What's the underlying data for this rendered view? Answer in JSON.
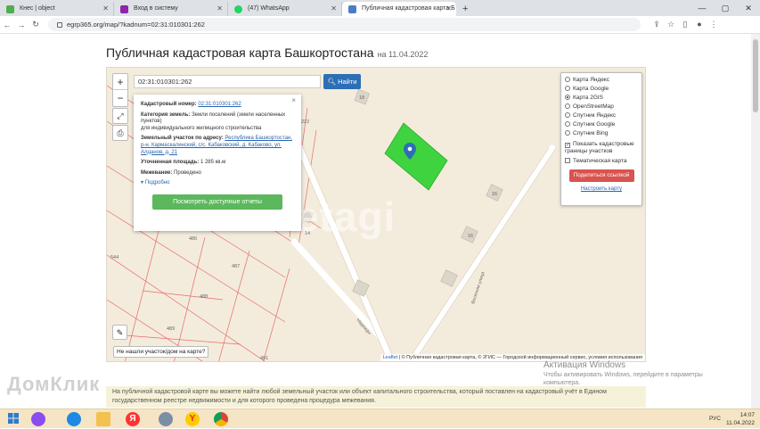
{
  "browser": {
    "tabs": [
      {
        "title": "Кнес | object",
        "color": "#4caf50",
        "active": false
      },
      {
        "title": "Вход в систему",
        "color": "#8e24aa",
        "active": false
      },
      {
        "title": "(47) WhatsApp",
        "color": "#25d366",
        "active": false
      },
      {
        "title": "Публичная кадастровая карта Б",
        "color": "#4a7cc7",
        "active": true
      }
    ],
    "new_tab": "+",
    "url": "egrp365.org/map/?kadnum=02:31:010301:262",
    "window_controls": [
      "—",
      "▢",
      "✕"
    ]
  },
  "page": {
    "title": "Публичная кадастровая карта Башкортостана",
    "date_suffix": "на 11.04.2022"
  },
  "map": {
    "search_value": "02:31:010301:262",
    "search_button": "Найти",
    "zoom_in": "+",
    "zoom_out": "−",
    "popup": {
      "close": "×",
      "cadnum_label": "Кадастровый номер:",
      "cadnum_value": "02:31:010301:262",
      "category_label": "Категория земель:",
      "category_value": "Земли поселений (земли населенных пунктов)",
      "category_value_2": "для индивидуального жилищного строительства",
      "address_label": "Земельный участок по адресу:",
      "address_value": "Республика Башкортостан, р-н. Кармаскалинский, с/с. Кабаковский, д. Кабаково, ул. Алданов, д. 21",
      "area_label": "Уточненная площадь:",
      "area_value": "1 285 кв.м",
      "survey_label": "Межевание:",
      "survey_value": "Проведено",
      "more_link": "Подробно",
      "report_button": "Посмотреть доступные отчеты"
    },
    "layers": {
      "options": [
        {
          "label": "Карта Яндекс",
          "selected": false
        },
        {
          "label": "Карта Google",
          "selected": false
        },
        {
          "label": "Карта 2GIS",
          "selected": true
        },
        {
          "label": "OpenStreetMap",
          "selected": false
        },
        {
          "label": "Спутник Яндекс",
          "selected": false
        },
        {
          "label": "Спутник Google",
          "selected": false
        },
        {
          "label": "Спутник Bing",
          "selected": false
        }
      ],
      "show_borders": "Показать кадастровые границы участков",
      "thematic": "Тематическая карта",
      "share_button": "Поделиться ссылкой",
      "setup_link": "Настроить карту"
    },
    "plot_numbers": [
      "222",
      "486",
      "544",
      "487",
      "488",
      "489",
      "491",
      "16",
      "16",
      "16",
      "14",
      "18"
    ],
    "street_labels": [
      "Весенняя улица",
      "Надежды"
    ],
    "watermark": "etagi",
    "not_found": "Не нашли участок/дом на карте?",
    "attribution_leaflet": "Leaflet",
    "attribution_text": "| © Публичная кадастровая карта, © 2ГИС — Городской информационный сервис, условия использования"
  },
  "notice": "На публичной кадастровой карте вы можете найти любой земельный участок или объект капитального строительства, который поставлен на кадастровый учёт в Едином государственном реестре недвижимости и для которого проведена процедура межевания.",
  "overlays": {
    "domklik": "ДомКлик",
    "activate_title": "Активация Windows",
    "activate_text": "Чтобы активировать Windows, перейдите в параметры компьютера."
  },
  "taskbar": {
    "lang": "РУС",
    "time": "14:07",
    "date": "11.04.2022"
  }
}
